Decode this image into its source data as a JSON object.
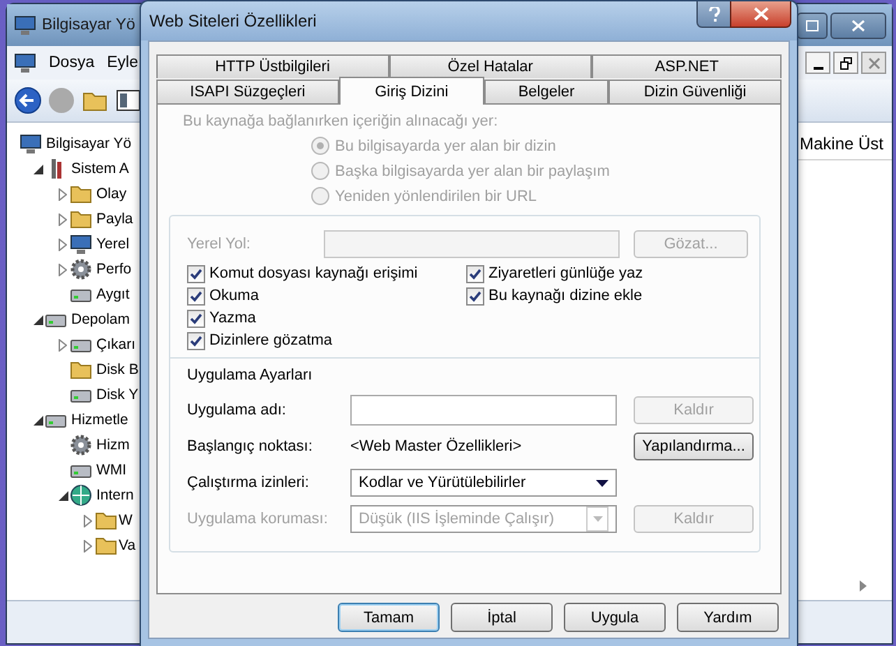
{
  "background_window": {
    "title": "Bilgisayar Yö",
    "menu": [
      "Dosya",
      "Eyle"
    ],
    "tree": [
      {
        "label": "Bilgisayar Yö",
        "children": [
          {
            "label": "Sistem A",
            "expanded": true,
            "children": [
              {
                "label": "Olay",
                "expanded": false
              },
              {
                "label": "Payla",
                "expanded": false
              },
              {
                "label": "Yerel",
                "expanded": false
              },
              {
                "label": "Perfo",
                "expanded": false
              },
              {
                "label": "Aygıt"
              }
            ]
          },
          {
            "label": "Depolam",
            "expanded": true,
            "children": [
              {
                "label": "Çıkarı",
                "expanded": false
              },
              {
                "label": "Disk B"
              },
              {
                "label": "Disk Y"
              }
            ]
          },
          {
            "label": "Hizmetle",
            "expanded": true,
            "children": [
              {
                "label": "Hizm"
              },
              {
                "label": "WMI"
              },
              {
                "label": "Intern",
                "expanded": true,
                "children": [
                  {
                    "label": "W",
                    "expanded": false
                  },
                  {
                    "label": "Va",
                    "expanded": false
                  }
                ]
              }
            ]
          }
        ]
      }
    ],
    "column_header": "Makine Üst"
  },
  "dialog": {
    "title": "Web Siteleri Özellikleri",
    "tab_rows": [
      [
        {
          "label": "HTTP Üstbilgileri",
          "selected": false
        },
        {
          "label": "Özel Hatalar",
          "selected": false
        },
        {
          "label": "ASP.NET",
          "selected": false
        }
      ],
      [
        {
          "label": "ISAPI Süzgeçleri",
          "selected": false
        },
        {
          "label": "Giriş Dizini",
          "selected": true
        },
        {
          "label": "Belgeler",
          "selected": false
        },
        {
          "label": "Dizin Güvenliği",
          "selected": false
        }
      ]
    ],
    "source": {
      "label": "Bu kaynağa bağlanırken içeriğin alınacağı yer:",
      "disabled": true,
      "options": [
        {
          "label": "Bu bilgisayarda yer alan bir dizin",
          "selected": true
        },
        {
          "label": "Başka bilgisayarda yer alan bir paylaşım",
          "selected": false
        },
        {
          "label": "Yeniden yönlendirilen bir URL",
          "selected": false
        }
      ]
    },
    "local_path": {
      "label": "Yerel Yol:",
      "browse": "Gözat...",
      "disabled": true
    },
    "permissions_left": [
      {
        "label": "Komut dosyası kaynağı erişimi",
        "checked": true
      },
      {
        "label": "Okuma",
        "checked": true
      },
      {
        "label": "Yazma",
        "checked": true
      },
      {
        "label": "Dizinlere gözatma",
        "checked": true
      }
    ],
    "permissions_right": [
      {
        "label": "Ziyaretleri günlüğe yaz",
        "checked": true
      },
      {
        "label": "Bu kaynağı dizine ekle",
        "checked": true
      }
    ],
    "app_settings": {
      "title": "Uygulama Ayarları",
      "rows": [
        {
          "kind": "field",
          "label": "Uygulama adı:",
          "disabled": false,
          "button": {
            "label": "Kaldır",
            "disabled": true
          }
        },
        {
          "kind": "text",
          "label": "Başlangıç noktası:",
          "value": "<Web Master Özellikleri>",
          "disabled": false,
          "button": {
            "label": "Yapılandırma...",
            "disabled": false
          }
        },
        {
          "kind": "dropdown",
          "label": "Çalıştırma izinleri:",
          "value": "Kodlar ve Yürütülebilirler",
          "disabled": false
        },
        {
          "kind": "dropdown",
          "label": "Uygulama koruması:",
          "value": "Düşük (IIS İşleminde Çalışır)",
          "disabled": true,
          "button": {
            "label": "Kaldır",
            "disabled": true
          }
        }
      ]
    },
    "buttons": [
      {
        "label": "Tamam",
        "default": true
      },
      {
        "label": "İptal",
        "default": false
      },
      {
        "label": "Uygula",
        "default": false
      },
      {
        "label": "Yardım",
        "default": false
      }
    ]
  }
}
